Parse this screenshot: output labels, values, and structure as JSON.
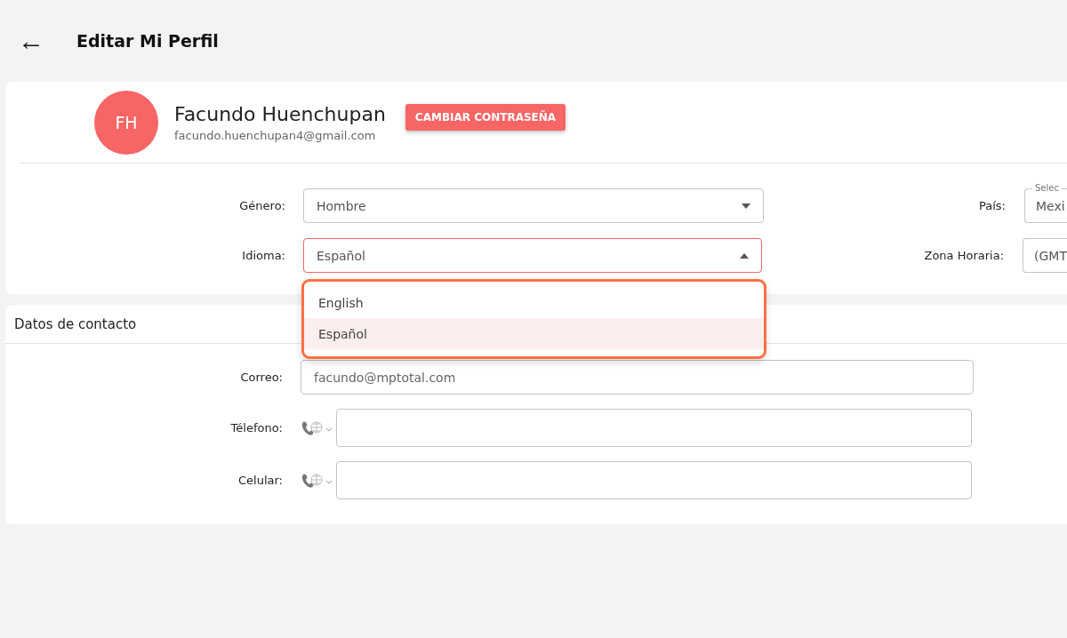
{
  "header": {
    "back_icon": "←",
    "title": "Editar Mi Perfil"
  },
  "profile": {
    "initials": "FH",
    "name": "Facundo Huenchupan",
    "email": "facundo.huenchupan4@gmail.com",
    "password_button": "CAMBIAR CONTRASEÑA"
  },
  "preferences": [
    {
      "label": "Género:",
      "value": "Hombre",
      "open": false,
      "right_label": "País:",
      "right_floating_label": "Selec",
      "right_value": "Mexi"
    },
    {
      "label": "Idioma:",
      "value": "Español",
      "open": true,
      "right_label": "Zona Horaria:",
      "right_value": "(GMT",
      "options": [
        {
          "label": "English",
          "selected": false
        },
        {
          "label": "Español",
          "selected": true
        }
      ]
    }
  ],
  "contact": {
    "title": "Datos de contacto",
    "fields": [
      {
        "kind": "text",
        "label": "Correo:",
        "value": "facundo@mptotal.com"
      },
      {
        "kind": "phone",
        "label": "Télefono:"
      },
      {
        "kind": "phone",
        "label": "Celular:"
      }
    ]
  }
}
